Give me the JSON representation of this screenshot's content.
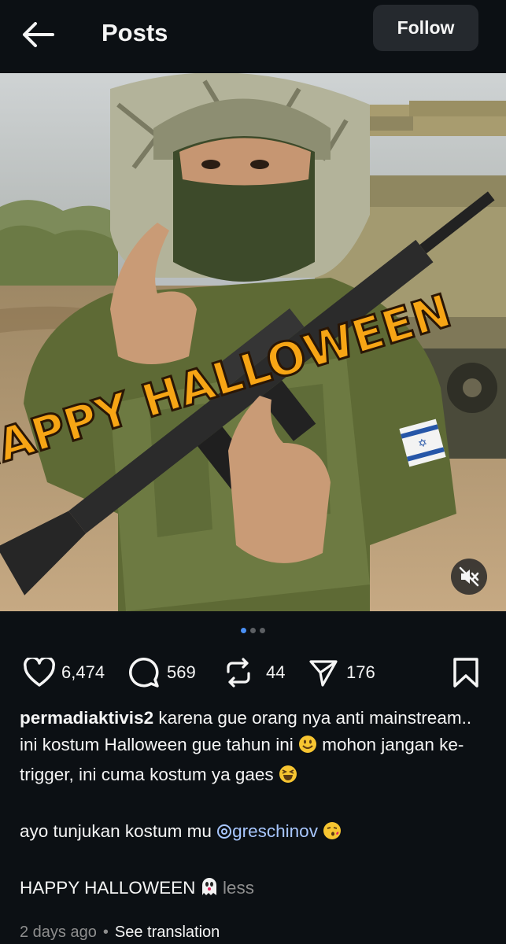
{
  "header": {
    "title": "Posts",
    "follow_label": "Follow"
  },
  "media": {
    "overlay_text": "HAPPY HALLOWEEN",
    "carousel_count": 3,
    "carousel_active_index": 0
  },
  "actions": {
    "likes": "6,474",
    "comments": "569",
    "reposts": "44",
    "shares": "176"
  },
  "caption": {
    "username": "permadiaktivis2",
    "line1": " karena gue orang nya anti mainstream.. ini kostum Halloween gue tahun ini ",
    "line1b": " mohon jangan ke-trigger, ini cuma kostum ya gaes ",
    "line2": "ayo tunjukan kostum mu ",
    "mention": "greschinov",
    "line3": "HAPPY HALLOWEEN ",
    "less_label": "less"
  },
  "meta": {
    "time_ago": "2 days ago",
    "separator": "•",
    "see_translation": "See translation"
  },
  "colors": {
    "background": "#0c1014",
    "follow_button": "#25292e",
    "mention": "#a8c7ff",
    "muted_text": "#8e8e8e",
    "active_dot": "#4a90f5"
  }
}
